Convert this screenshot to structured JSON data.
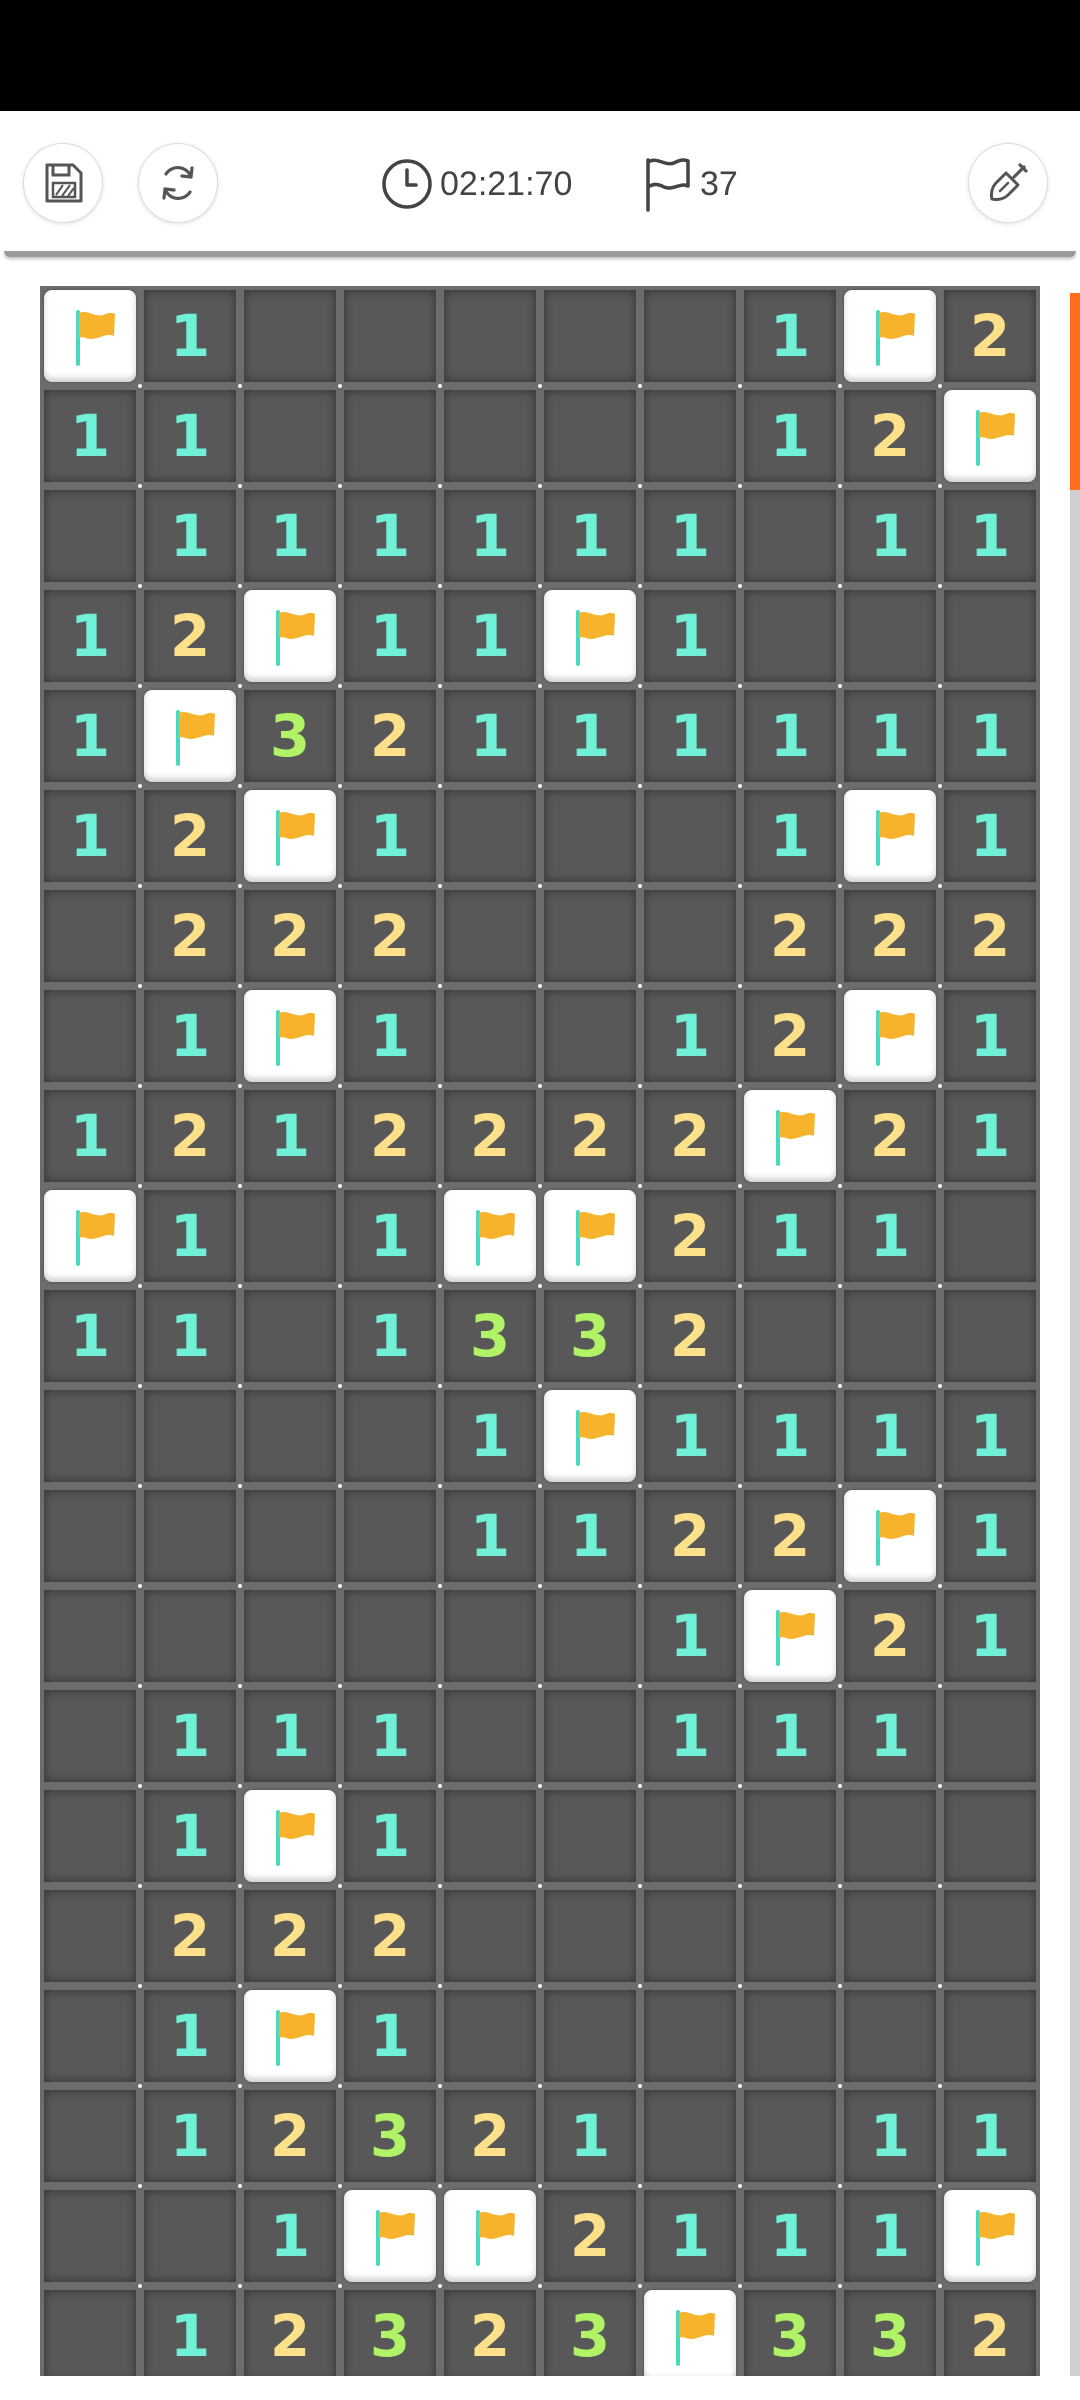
{
  "toolbar": {
    "save_icon": "save-icon",
    "restart_icon": "refresh-icon",
    "timer_icon": "clock-icon",
    "timer": "02:21:70",
    "flag_icon": "flag-icon",
    "flags_remaining": "37",
    "tool_icon": "shovel-icon"
  },
  "colors": {
    "num1": "#6ff0d7",
    "num2": "#fce08a",
    "num3": "#b1f267",
    "flag": "#f7b32b",
    "pole": "#4ad8be",
    "accent": "#ff6d1e"
  },
  "board": {
    "rows": [
      [
        "F",
        "1",
        "",
        "",
        "",
        "",
        "",
        "1",
        "F",
        "2"
      ],
      [
        "1",
        "1",
        "",
        "",
        "",
        "",
        "",
        "1",
        "2",
        "F"
      ],
      [
        "",
        "1",
        "1",
        "1",
        "1",
        "1",
        "1",
        "",
        "1",
        "1"
      ],
      [
        "1",
        "2",
        "F",
        "1",
        "1",
        "F",
        "1",
        "",
        "",
        ""
      ],
      [
        "1",
        "F",
        "3",
        "2",
        "1",
        "1",
        "1",
        "1",
        "1",
        "1"
      ],
      [
        "1",
        "2",
        "F",
        "1",
        "",
        "",
        "",
        "1",
        "F",
        "1"
      ],
      [
        "",
        "2",
        "2",
        "2",
        "",
        "",
        "",
        "2",
        "2",
        "2"
      ],
      [
        "",
        "1",
        "F",
        "1",
        "",
        "",
        "1",
        "2",
        "F",
        "1"
      ],
      [
        "1",
        "2",
        "1",
        "2",
        "2",
        "2",
        "2",
        "F",
        "2",
        "1"
      ],
      [
        "F",
        "1",
        "",
        "1",
        "F",
        "F",
        "2",
        "1",
        "1",
        ""
      ],
      [
        "1",
        "1",
        "",
        "1",
        "3",
        "3",
        "2",
        "",
        "",
        ""
      ],
      [
        "",
        "",
        "",
        "",
        "1",
        "F",
        "1",
        "1",
        "1",
        "1"
      ],
      [
        "",
        "",
        "",
        "",
        "1",
        "1",
        "2",
        "2",
        "F",
        "1"
      ],
      [
        "",
        "",
        "",
        "",
        "",
        "",
        "1",
        "F",
        "2",
        "1"
      ],
      [
        "",
        "1",
        "1",
        "1",
        "",
        "",
        "1",
        "1",
        "1",
        ""
      ],
      [
        "",
        "1",
        "F",
        "1",
        "",
        "",
        "",
        "",
        "",
        ""
      ],
      [
        "",
        "2",
        "2",
        "2",
        "",
        "",
        "",
        "",
        "",
        ""
      ],
      [
        "",
        "1",
        "F",
        "1",
        "",
        "",
        "",
        "",
        "",
        ""
      ],
      [
        "",
        "1",
        "2",
        "3",
        "2",
        "1",
        "",
        "",
        "1",
        "1"
      ],
      [
        "",
        "",
        "1",
        "F",
        "F",
        "2",
        "1",
        "1",
        "1",
        "F"
      ],
      [
        "",
        "1",
        "2",
        "3",
        "2",
        "3",
        "F",
        "3",
        "3",
        "2"
      ]
    ]
  }
}
